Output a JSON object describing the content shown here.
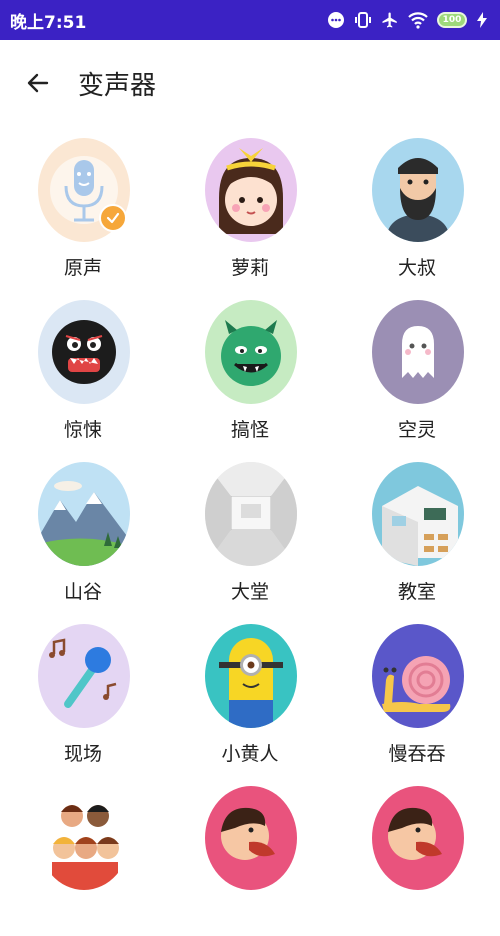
{
  "status_bar": {
    "time": "晚上7:51",
    "battery": "100"
  },
  "app_bar": {
    "title": "变声器"
  },
  "voice_effects": [
    {
      "label": "原声",
      "icon": "microphone-icon",
      "selected": true
    },
    {
      "label": "萝莉",
      "icon": "loli-girl-icon"
    },
    {
      "label": "大叔",
      "icon": "uncle-icon"
    },
    {
      "label": "惊悚",
      "icon": "monster-icon"
    },
    {
      "label": "搞怪",
      "icon": "green-devil-icon"
    },
    {
      "label": "空灵",
      "icon": "ghost-icon"
    },
    {
      "label": "山谷",
      "icon": "mountain-valley-icon"
    },
    {
      "label": "大堂",
      "icon": "hall-icon"
    },
    {
      "label": "教室",
      "icon": "classroom-icon"
    },
    {
      "label": "现场",
      "icon": "live-mic-icon"
    },
    {
      "label": "小黄人",
      "icon": "minion-icon"
    },
    {
      "label": "慢吞吞",
      "icon": "snail-icon"
    },
    {
      "label": "",
      "icon": "chorus-icon"
    },
    {
      "label": "",
      "icon": "singer-icon"
    },
    {
      "label": "",
      "icon": "singer-icon"
    }
  ],
  "colors": {
    "status_bar": "#3b22c4",
    "check_badge": "#f6a73a"
  }
}
